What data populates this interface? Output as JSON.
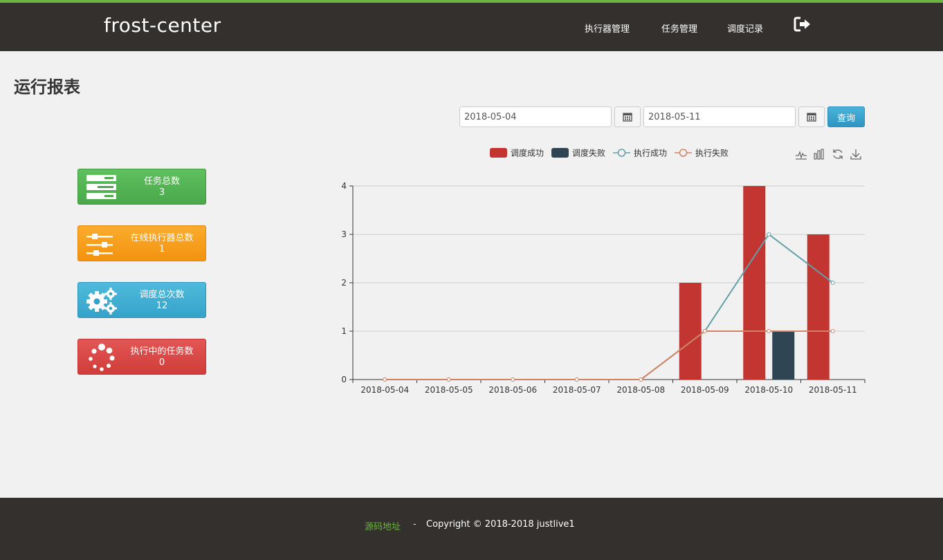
{
  "header": {
    "brand": "frost-center",
    "nav": [
      "执行器管理",
      "任务管理",
      "调度记录"
    ],
    "logout_icon": "sign-out-icon"
  },
  "page": {
    "title": "运行报表"
  },
  "filters": {
    "start_date": "2018-05-04",
    "end_date": "2018-05-11",
    "query_label": "查询",
    "calendar_icon": "calendar-icon"
  },
  "cards": [
    {
      "title": "任务总数",
      "value": "3",
      "color": "#5cb85c",
      "icon": "server-icon"
    },
    {
      "title": "在线执行器总数",
      "value": "1",
      "color": "#f0ad4e",
      "icon": "sliders-icon"
    },
    {
      "title": "调度总次数",
      "value": "12",
      "color": "#5bc0de",
      "icon": "gears-icon"
    },
    {
      "title": "执行中的任务数",
      "value": "0",
      "color": "#d9534f",
      "icon": "spinner-icon"
    }
  ],
  "chart_data": {
    "type": "bar",
    "categories": [
      "2018-05-04",
      "2018-05-05",
      "2018-05-06",
      "2018-05-07",
      "2018-05-08",
      "2018-05-09",
      "2018-05-10",
      "2018-05-11"
    ],
    "ylim": [
      0,
      4
    ],
    "yticks": [
      "0",
      "1",
      "2",
      "3",
      "4"
    ],
    "grid": true,
    "legend_position": "top-center",
    "series": [
      {
        "name": "调度成功",
        "type": "bar",
        "color": "#c23531",
        "values": [
          0,
          0,
          0,
          0,
          0,
          2,
          4,
          3
        ]
      },
      {
        "name": "调度失败",
        "type": "bar",
        "color": "#2f4554",
        "values": [
          0,
          0,
          0,
          0,
          0,
          0,
          1,
          0
        ]
      },
      {
        "name": "执行成功",
        "type": "line",
        "color": "#61a0a8",
        "values": [
          0,
          0,
          0,
          0,
          0,
          1,
          3,
          2
        ]
      },
      {
        "name": "执行失败",
        "type": "line",
        "color": "#d48265",
        "values": [
          0,
          0,
          0,
          0,
          0,
          1,
          1,
          1
        ]
      }
    ],
    "toolbox": [
      "line-chart-icon",
      "bar-chart-icon",
      "refresh-icon",
      "download-icon"
    ]
  },
  "footer": {
    "source_link": "源码地址",
    "separator": "-",
    "copyright": "Copyright © 2018-2018 justlive1"
  }
}
